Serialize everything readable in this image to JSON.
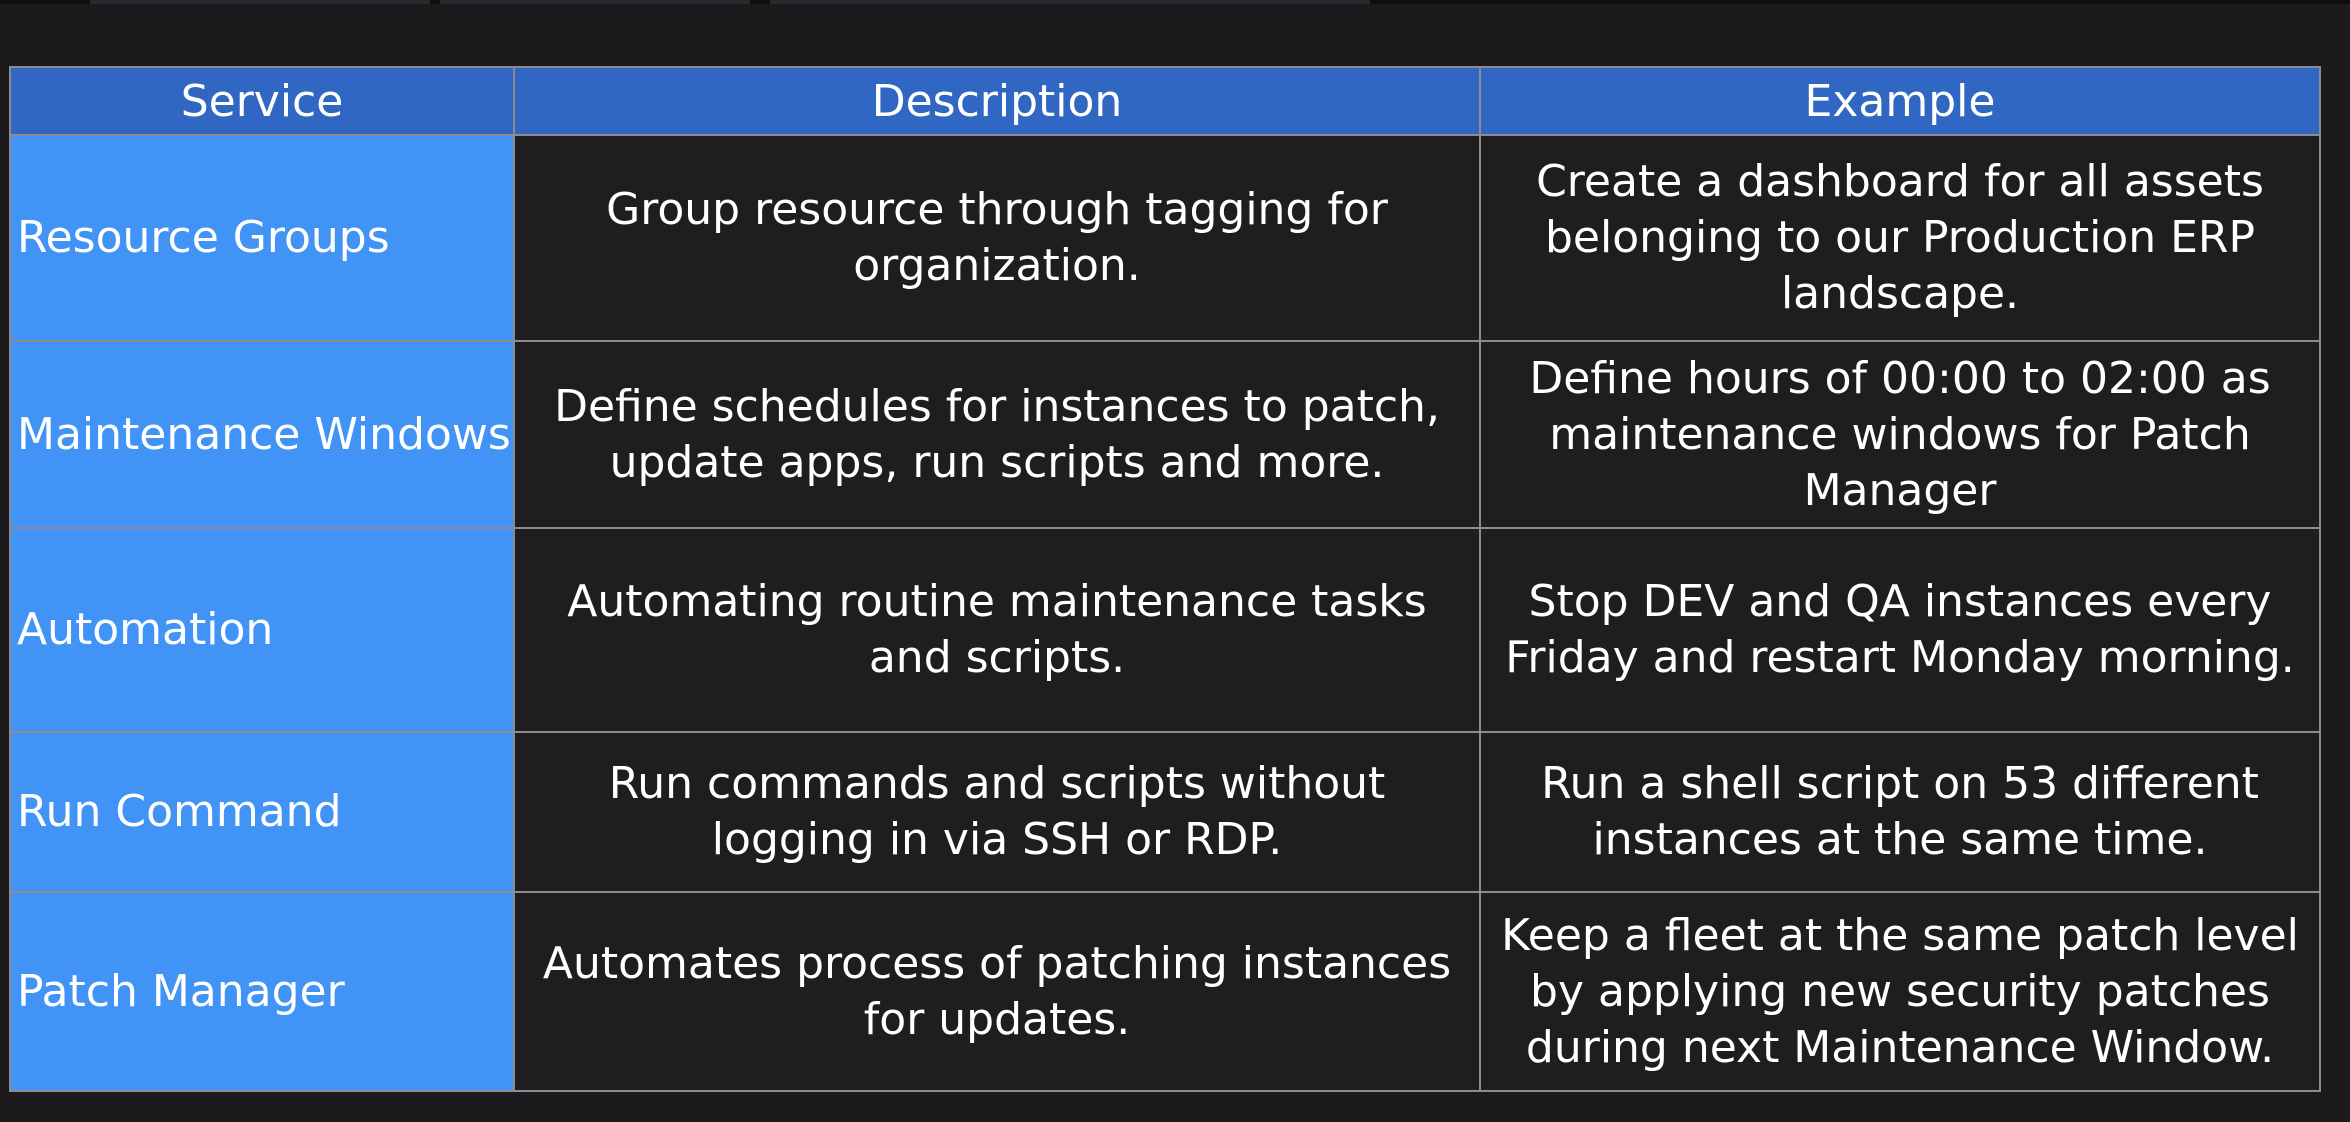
{
  "table": {
    "headers": [
      "Service",
      "Description",
      "Example"
    ],
    "rows": [
      {
        "service": "Resource Groups",
        "description": "Group resource through tagging for organization.",
        "example": "Create a dashboard for all assets belonging to our Production ERP landscape."
      },
      {
        "service": "Maintenance Windows",
        "description": "Define schedules for instances to patch, update apps, run scripts and more.",
        "example": "Define hours of 00:00 to 02:00 as maintenance windows for Patch Manager"
      },
      {
        "service": "Automation",
        "description": "Automating routine maintenance tasks and scripts.",
        "example": "Stop DEV and QA instances every Friday and restart Monday morning."
      },
      {
        "service": "Run Command",
        "description": "Run commands and scripts without logging in via SSH or RDP.",
        "example": "Run a shell script on 53 different instances at the same time."
      },
      {
        "service": "Patch Manager",
        "description": "Automates process of patching instances for updates.",
        "example": "Keep a fleet at the same patch level by applying new security patches during next Maintenance Window."
      }
    ]
  },
  "colors": {
    "background": "#1c1a1d",
    "header_bg": "#3067c2",
    "service_col_bg": "#4193f5",
    "cell_bg": "#1f1d20",
    "border": "#8c8c8f",
    "text": "#ffffff"
  }
}
